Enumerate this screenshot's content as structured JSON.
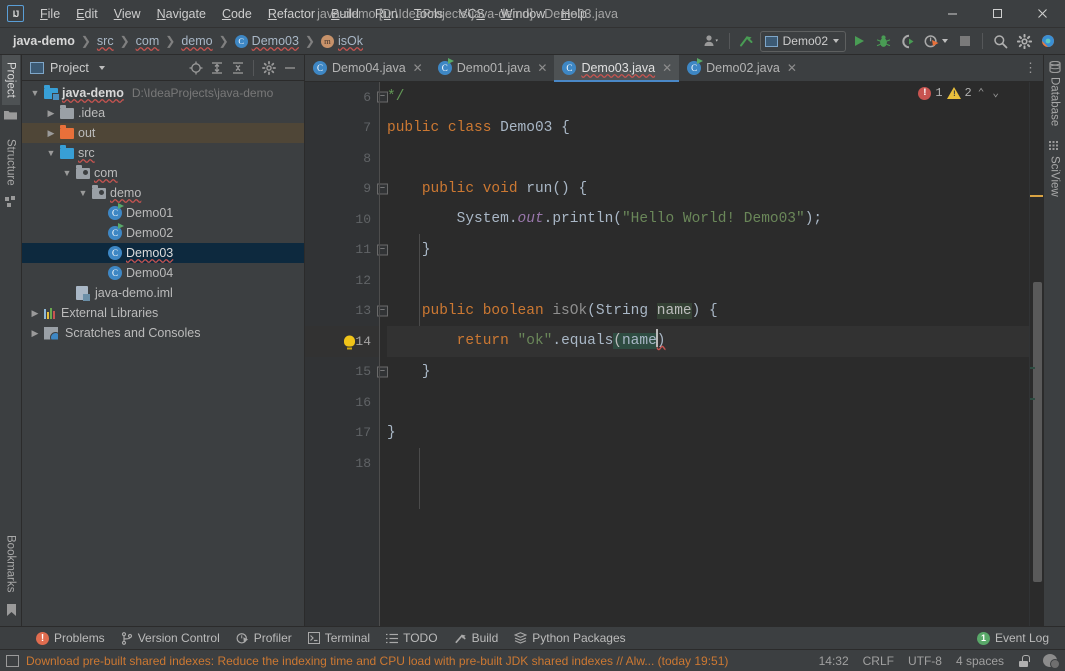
{
  "window": {
    "title": "java-demo [D:\\IdeaProjects\\java-demo] - Demo03.java",
    "logo": "IJ",
    "minimize": "—",
    "maximize": "☐",
    "close": "✕"
  },
  "menu": {
    "items": [
      {
        "label": "File",
        "mnemonic_index": 0
      },
      {
        "label": "Edit",
        "mnemonic_index": 0
      },
      {
        "label": "View",
        "mnemonic_index": 0
      },
      {
        "label": "Navigate",
        "mnemonic_index": 0
      },
      {
        "label": "Code",
        "mnemonic_index": 0
      },
      {
        "label": "Refactor",
        "mnemonic_index": 0
      },
      {
        "label": "Build",
        "mnemonic_index": 0
      },
      {
        "label": "Run",
        "mnemonic_index": 1
      },
      {
        "label": "Tools",
        "mnemonic_index": 0
      },
      {
        "label": "VCS",
        "mnemonic_index": 2
      },
      {
        "label": "Window",
        "mnemonic_index": 0
      },
      {
        "label": "Help",
        "mnemonic_index": 0
      }
    ]
  },
  "navbar": {
    "crumbs": [
      {
        "label": "java-demo",
        "icon": "none",
        "root": true
      },
      {
        "label": "src",
        "icon": "none"
      },
      {
        "label": "com",
        "icon": "none"
      },
      {
        "label": "demo",
        "icon": "none"
      },
      {
        "label": "Demo03",
        "icon": "class-icon",
        "glyph": "C"
      },
      {
        "label": "isOk",
        "icon": "method-icon",
        "glyph": "m"
      }
    ],
    "separator": "❯",
    "toolbar": {
      "account_icon": "user-account-icon",
      "update_icon": "update-project-icon",
      "run_config": "Demo02",
      "run_icon": "run-icon",
      "debug_icon": "debug-icon",
      "run_coverage_icon": "run-with-coverage-icon",
      "profiler_icon": "profiler-icon",
      "stop_icon": "stop-icon",
      "search_icon": "search-everywhere-icon",
      "settings_icon": "settings-gear-icon",
      "ai_icon": "ai-assistant-icon"
    }
  },
  "left_rail": {
    "top": [
      {
        "label": "Project",
        "icon": "project-icon",
        "active": true
      },
      {
        "label": "Structure",
        "icon": "structure-icon",
        "active": false
      }
    ],
    "bottom": [
      {
        "label": "Bookmarks",
        "icon": "bookmarks-icon",
        "active": false
      }
    ]
  },
  "right_rail": {
    "items": [
      {
        "label": "Database",
        "icon": "database-icon"
      },
      {
        "label": "SciView",
        "icon": "sciview-icon"
      }
    ]
  },
  "project_panel": {
    "title": "Project",
    "title_icon": "project-view-icon",
    "tools": [
      {
        "name": "select-opened-file-icon",
        "glyph": "⨁"
      },
      {
        "name": "expand-all-icon",
        "glyph": "≡"
      },
      {
        "name": "collapse-all-icon",
        "glyph": "≡"
      },
      {
        "name": "options-gear-icon",
        "glyph": "⚙"
      },
      {
        "name": "hide-panel-icon",
        "glyph": "—"
      }
    ],
    "tree": [
      {
        "label": "java-demo",
        "suffix": "D:\\IdeaProjects\\java-demo",
        "indent": 0,
        "arrow": "down",
        "icon": "module-folder",
        "bold": true
      },
      {
        "label": ".idea",
        "indent": 1,
        "arrow": "right",
        "icon": "folder-gray"
      },
      {
        "label": "out",
        "indent": 1,
        "arrow": "right",
        "icon": "folder-orange",
        "highlight": "out"
      },
      {
        "label": "src",
        "indent": 1,
        "arrow": "down",
        "icon": "folder-blue",
        "spellcheck": true
      },
      {
        "label": "com",
        "indent": 2,
        "arrow": "down",
        "icon": "package",
        "spellcheck": true
      },
      {
        "label": "demo",
        "indent": 3,
        "arrow": "down",
        "icon": "package",
        "spellcheck": true
      },
      {
        "label": "Demo01",
        "indent": 4,
        "arrow": "none",
        "icon": "class-runnable"
      },
      {
        "label": "Demo02",
        "indent": 4,
        "arrow": "none",
        "icon": "class-runnable"
      },
      {
        "label": "Demo03",
        "indent": 4,
        "arrow": "none",
        "icon": "class",
        "selected": true,
        "spellcheck": true
      },
      {
        "label": "Demo04",
        "indent": 4,
        "arrow": "none",
        "icon": "class"
      },
      {
        "label": "java-demo.iml",
        "indent": 2,
        "arrow": "none",
        "icon": "iml"
      },
      {
        "label": "External Libraries",
        "indent": 0,
        "arrow": "right",
        "icon": "libraries"
      },
      {
        "label": "Scratches and Consoles",
        "indent": 0,
        "arrow": "right",
        "icon": "scratches"
      }
    ]
  },
  "editor": {
    "tabs": [
      {
        "label": "Demo04.java",
        "icon": "class-icon",
        "runnable": false,
        "active": false
      },
      {
        "label": "Demo01.java",
        "icon": "class-icon",
        "runnable": true,
        "active": false
      },
      {
        "label": "Demo03.java",
        "icon": "class-icon",
        "runnable": false,
        "active": true,
        "spellcheck": true
      },
      {
        "label": "Demo02.java",
        "icon": "class-icon",
        "runnable": true,
        "active": false
      }
    ],
    "tab_close": "✕",
    "tab_overflow_icon": "tab-list-icon",
    "inspections": {
      "error_count": "1",
      "warning_count": "2",
      "error_glyph": "!",
      "up_icon": "⌃",
      "down_icon": "⌄"
    },
    "line_numbers": [
      "6",
      "7",
      "8",
      "9",
      "10",
      "11",
      "12",
      "13",
      "14",
      "15",
      "16",
      "17",
      "18"
    ],
    "current_line": "14",
    "lines": [
      {
        "num": "6",
        "text": "*/"
      },
      {
        "num": "7",
        "text": "public class Demo03 {"
      },
      {
        "num": "8",
        "text": ""
      },
      {
        "num": "9",
        "text": "    public void run() {"
      },
      {
        "num": "10",
        "text": "        System.out.println(\"Hello World! Demo03\");"
      },
      {
        "num": "11",
        "text": "    }"
      },
      {
        "num": "12",
        "text": ""
      },
      {
        "num": "13",
        "text": "    public boolean isOk(String name) {"
      },
      {
        "num": "14",
        "text": "        return \"ok\".equals(name)"
      },
      {
        "num": "15",
        "text": "    }"
      },
      {
        "num": "16",
        "text": ""
      },
      {
        "num": "17",
        "text": "}"
      },
      {
        "num": "18",
        "text": ""
      }
    ],
    "intention_bulb": "intention-bulb-icon",
    "colors": {
      "background": "#2b2b2b",
      "gutter": "#313335",
      "current_line": "#323232",
      "keyword": "#cc7832",
      "string": "#6a8759",
      "comment": "#629755",
      "identifier": "#a9b7c6",
      "static_field": "#9876aa",
      "method": "#8f8f8f",
      "error_stripe": "#c75450",
      "warning_stripe": "#e8bf3c"
    }
  },
  "bottom_bar": {
    "items": [
      {
        "label": "Problems",
        "icon": "problems-icon"
      },
      {
        "label": "Version Control",
        "icon": "version-control-icon"
      },
      {
        "label": "Profiler",
        "icon": "profiler-icon"
      },
      {
        "label": "Terminal",
        "icon": "terminal-icon"
      },
      {
        "label": "TODO",
        "icon": "todo-icon"
      },
      {
        "label": "Build",
        "icon": "build-icon"
      },
      {
        "label": "Python Packages",
        "icon": "python-packages-icon"
      }
    ],
    "event_log": {
      "label": "Event Log",
      "count": "1"
    }
  },
  "statusbar": {
    "message": "Download pre-built shared indexes: Reduce the indexing time and CPU load with pre-built JDK shared indexes // Alw... (today 19:51)",
    "message_icon": "notification-icon",
    "caret_position": "14:32",
    "line_separator": "CRLF",
    "encoding": "UTF-8",
    "indent": "4 spaces",
    "lock_icon": "read-only-lock-icon",
    "inspection_icon": "inspection-profile-icon"
  }
}
